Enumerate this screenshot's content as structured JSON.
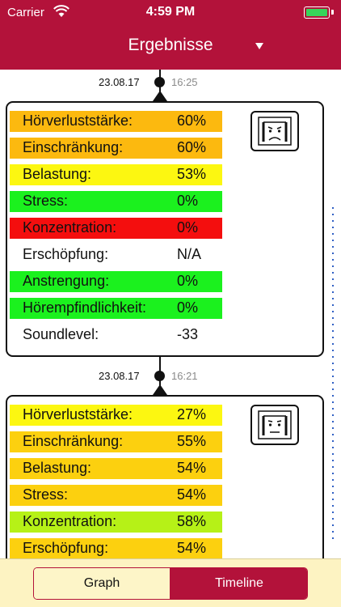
{
  "status_bar": {
    "carrier": "Carrier",
    "time": "4:59 PM",
    "battery_color": "#37d65a"
  },
  "nav": {
    "title": "Ergebnisse"
  },
  "entries": [
    {
      "date": "23.08.17",
      "time": "16:25",
      "face": "sad-face-icon",
      "rows": [
        {
          "label": "Hörverluststärke:",
          "value": "60%",
          "color": "#fcb90f"
        },
        {
          "label": "Einschränkung:",
          "value": "60%",
          "color": "#fcb90f"
        },
        {
          "label": "Belastung:",
          "value": "53%",
          "color": "#fcf711"
        },
        {
          "label": "Stress:",
          "value": "0%",
          "color": "#1bf11e"
        },
        {
          "label": "Konzentration:",
          "value": "0%",
          "color": "#f40e0e"
        },
        {
          "label": "Erschöpfung:",
          "value": "N/A",
          "color": "#ffffff"
        },
        {
          "label": "Anstrengung:",
          "value": "0%",
          "color": "#1bf11e"
        },
        {
          "label": "Hörempfindlichkeit:",
          "value": "0%",
          "color": "#1bf11e"
        },
        {
          "label": "Soundlevel:",
          "value": "-33",
          "color": "#ffffff"
        }
      ]
    },
    {
      "date": "23.08.17",
      "time": "16:21",
      "face": "neutral-face-icon",
      "rows": [
        {
          "label": "Hörverluststärke:",
          "value": "27%",
          "color": "#fcf711"
        },
        {
          "label": "Einschränkung:",
          "value": "55%",
          "color": "#fcd00f"
        },
        {
          "label": "Belastung:",
          "value": "54%",
          "color": "#fcd00f"
        },
        {
          "label": "Stress:",
          "value": "54%",
          "color": "#fcd00f"
        },
        {
          "label": "Konzentration:",
          "value": "58%",
          "color": "#b6f117"
        },
        {
          "label": "Erschöpfung:",
          "value": "54%",
          "color": "#fcd00f"
        }
      ]
    }
  ],
  "tabs": {
    "graph": "Graph",
    "timeline": "Timeline",
    "active": "Timeline"
  },
  "colors": {
    "brand": "#b3123a",
    "tabbar_bg": "#fdf3c2"
  }
}
